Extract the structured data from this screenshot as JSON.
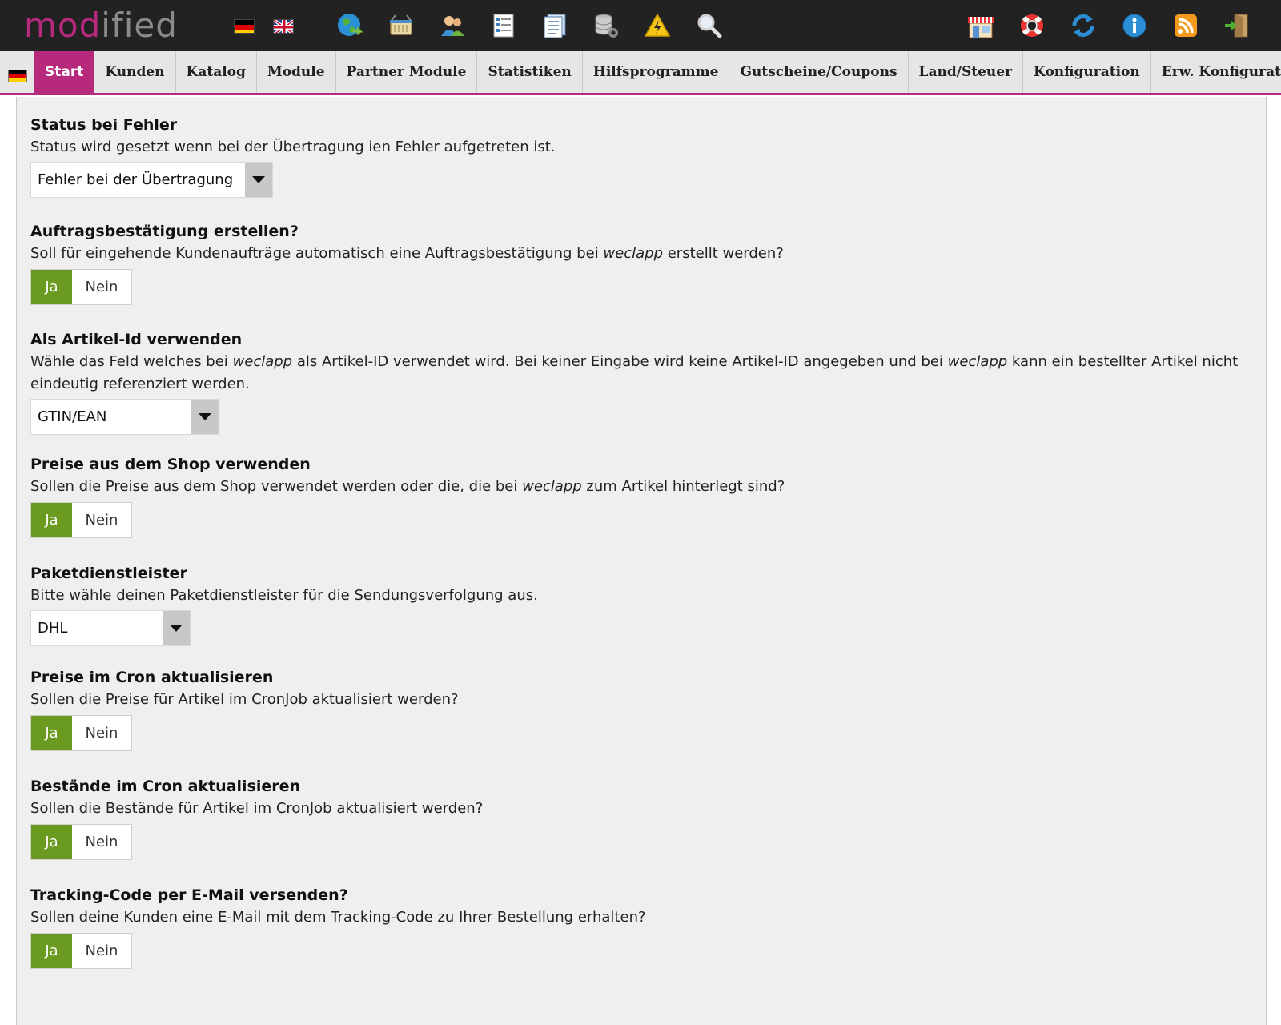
{
  "app": {
    "logo_part1": "mod",
    "logo_part2": "ified"
  },
  "header": {
    "flags": [
      "flag-de-icon",
      "flag-uk-icon"
    ],
    "icons_left": [
      "globe-icon",
      "basket-icon",
      "customers-icon",
      "list-icon",
      "notes-icon",
      "database-settings-icon",
      "warning-icon",
      "search-icon"
    ],
    "icons_right": [
      "shop-icon",
      "lifebuoy-icon",
      "refresh-icon",
      "info-icon",
      "rss-icon",
      "logout-icon"
    ]
  },
  "nav": {
    "tabs": [
      "Start",
      "Kunden",
      "Katalog",
      "Module",
      "Partner Module",
      "Statistiken",
      "Hilfsprogramme",
      "Gutscheine/Coupons",
      "Land/Steuer",
      "Konfiguration",
      "Erw. Konfiguration"
    ],
    "active_tab": "Start"
  },
  "settings": {
    "status_error": {
      "title": "Status bei Fehler",
      "desc": "Status wird gesetzt wenn bei der Übertragung ien Fehler aufgetreten ist.",
      "value": "Fehler bei der Übertragung"
    },
    "order_confirmation": {
      "title": "Auftragsbestätigung erstellen?",
      "desc_a": "Soll für eingehende Kundenaufträge automatisch eine Auftragsbestätigung bei ",
      "desc_em": "weclapp",
      "desc_b": " erstellt werden?",
      "yes": "Ja",
      "no": "Nein",
      "selected": "Ja"
    },
    "article_id": {
      "title": "Als Artikel-Id verwenden",
      "desc_a": "Wähle das Feld welches bei ",
      "desc_em1": "weclapp",
      "desc_b": " als Artikel-ID verwendet wird. Bei keiner Eingabe wird keine Artikel-ID angegeben und bei ",
      "desc_em2": "weclapp",
      "desc_c": " kann ein bestellter Artikel nicht eindeutig referenziert werden.",
      "value": "GTIN/EAN"
    },
    "shop_prices": {
      "title": "Preise aus dem Shop verwenden",
      "desc_a": "Sollen die Preise aus dem Shop verwendet werden oder die, die bei ",
      "desc_em": "weclapp",
      "desc_b": " zum Artikel hinterlegt sind?",
      "yes": "Ja",
      "no": "Nein",
      "selected": "Ja"
    },
    "carrier": {
      "title": "Paketdienstleister",
      "desc": "Bitte wähle deinen Paketdienstleister für die Sendungsverfolgung aus.",
      "value": "DHL"
    },
    "cron_prices": {
      "title": "Preise im Cron aktualisieren",
      "desc": "Sollen die Preise für Artikel im CronJob aktualisiert werden?",
      "yes": "Ja",
      "no": "Nein",
      "selected": "Ja"
    },
    "cron_stock": {
      "title": "Bestände im Cron aktualisieren",
      "desc": "Sollen die Bestände für Artikel im CronJob aktualisiert werden?",
      "yes": "Ja",
      "no": "Nein",
      "selected": "Ja"
    },
    "tracking_mail": {
      "title": "Tracking-Code per E-Mail versenden?",
      "desc": "Sollen deine Kunden eine E-Mail mit dem Tracking-Code zu Ihrer Bestellung erhalten?",
      "yes": "Ja",
      "no": "Nein",
      "selected": "Ja"
    }
  },
  "colors": {
    "brand": "#b6297d",
    "toggle_active": "#6a9a1f",
    "topbar": "#222222"
  }
}
